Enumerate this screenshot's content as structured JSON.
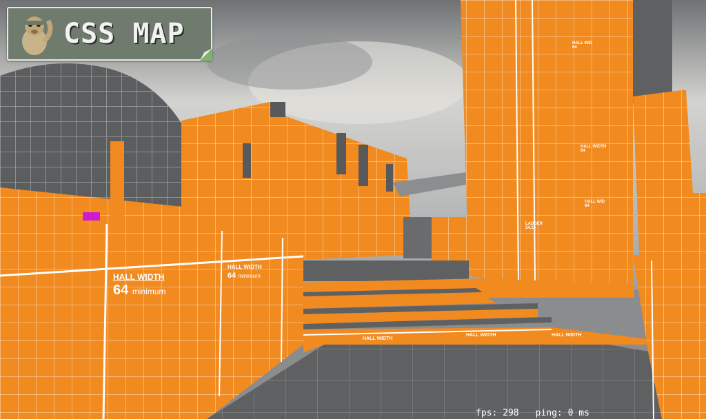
{
  "badge": {
    "title": "CSS MAP"
  },
  "hud": {
    "fps": "fps: 298",
    "ping": "ping: 0 ms"
  },
  "labels": {
    "hall_width_main": "HALL WIDTH",
    "hall_value_main": "64",
    "hall_min_main": "minimum",
    "hall_width_b": "HALL WIDTH",
    "hall_value_b": "64",
    "hall_min_b": "minimum",
    "floor_1": "HALL WIDTH",
    "floor_2": "HALL WIDTH",
    "floor_3": "HALL WIDTH",
    "tower_1": "HALL WID",
    "tower_1_val": "64",
    "tower_2": "LADDER",
    "tower_2_val": "24,16",
    "tower_3": "HALL WIDTH",
    "tower_3_val": "64",
    "tower_4": "HALL WID",
    "tower_4_val": "64"
  },
  "colors": {
    "orange": "#f18a1f",
    "gray": "#5f6062",
    "sky": "#b9bcbd",
    "line": "#ffffff"
  }
}
